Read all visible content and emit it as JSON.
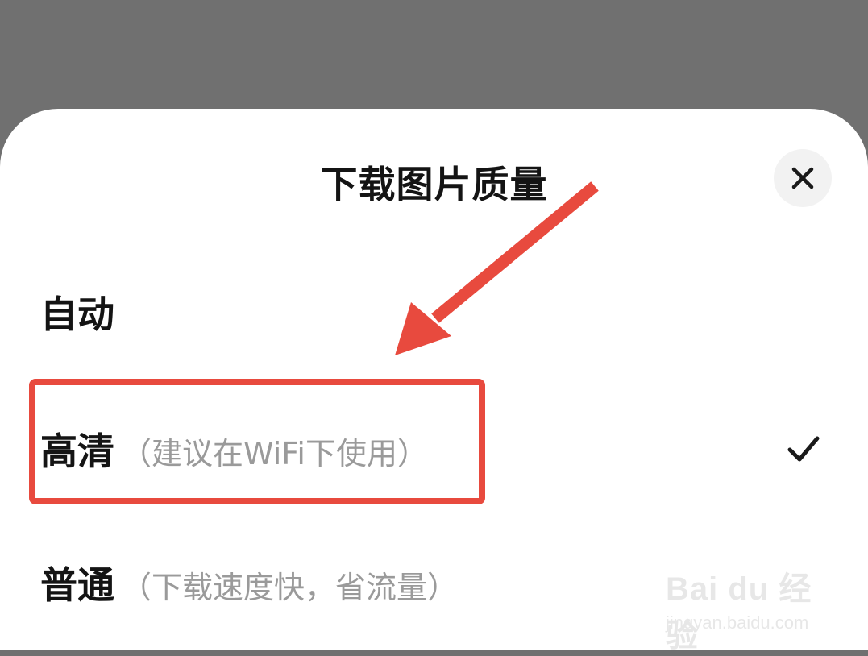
{
  "sheet": {
    "title": "下载图片质量",
    "close_icon": "close-icon"
  },
  "options": [
    {
      "label": "自动",
      "desc": "",
      "selected": false
    },
    {
      "label": "高清",
      "desc": "（建议在WiFi下使用）",
      "selected": true
    },
    {
      "label": "普通",
      "desc": "（下载速度快，省流量）",
      "selected": false
    }
  ],
  "colors": {
    "backdrop": "#707070",
    "sheet": "#ffffff",
    "annotation": "#e84a3e",
    "desc_text": "#9a9a9a"
  },
  "watermark": {
    "logo": "Bai du 经验",
    "url": "jingyan.baidu.com"
  }
}
